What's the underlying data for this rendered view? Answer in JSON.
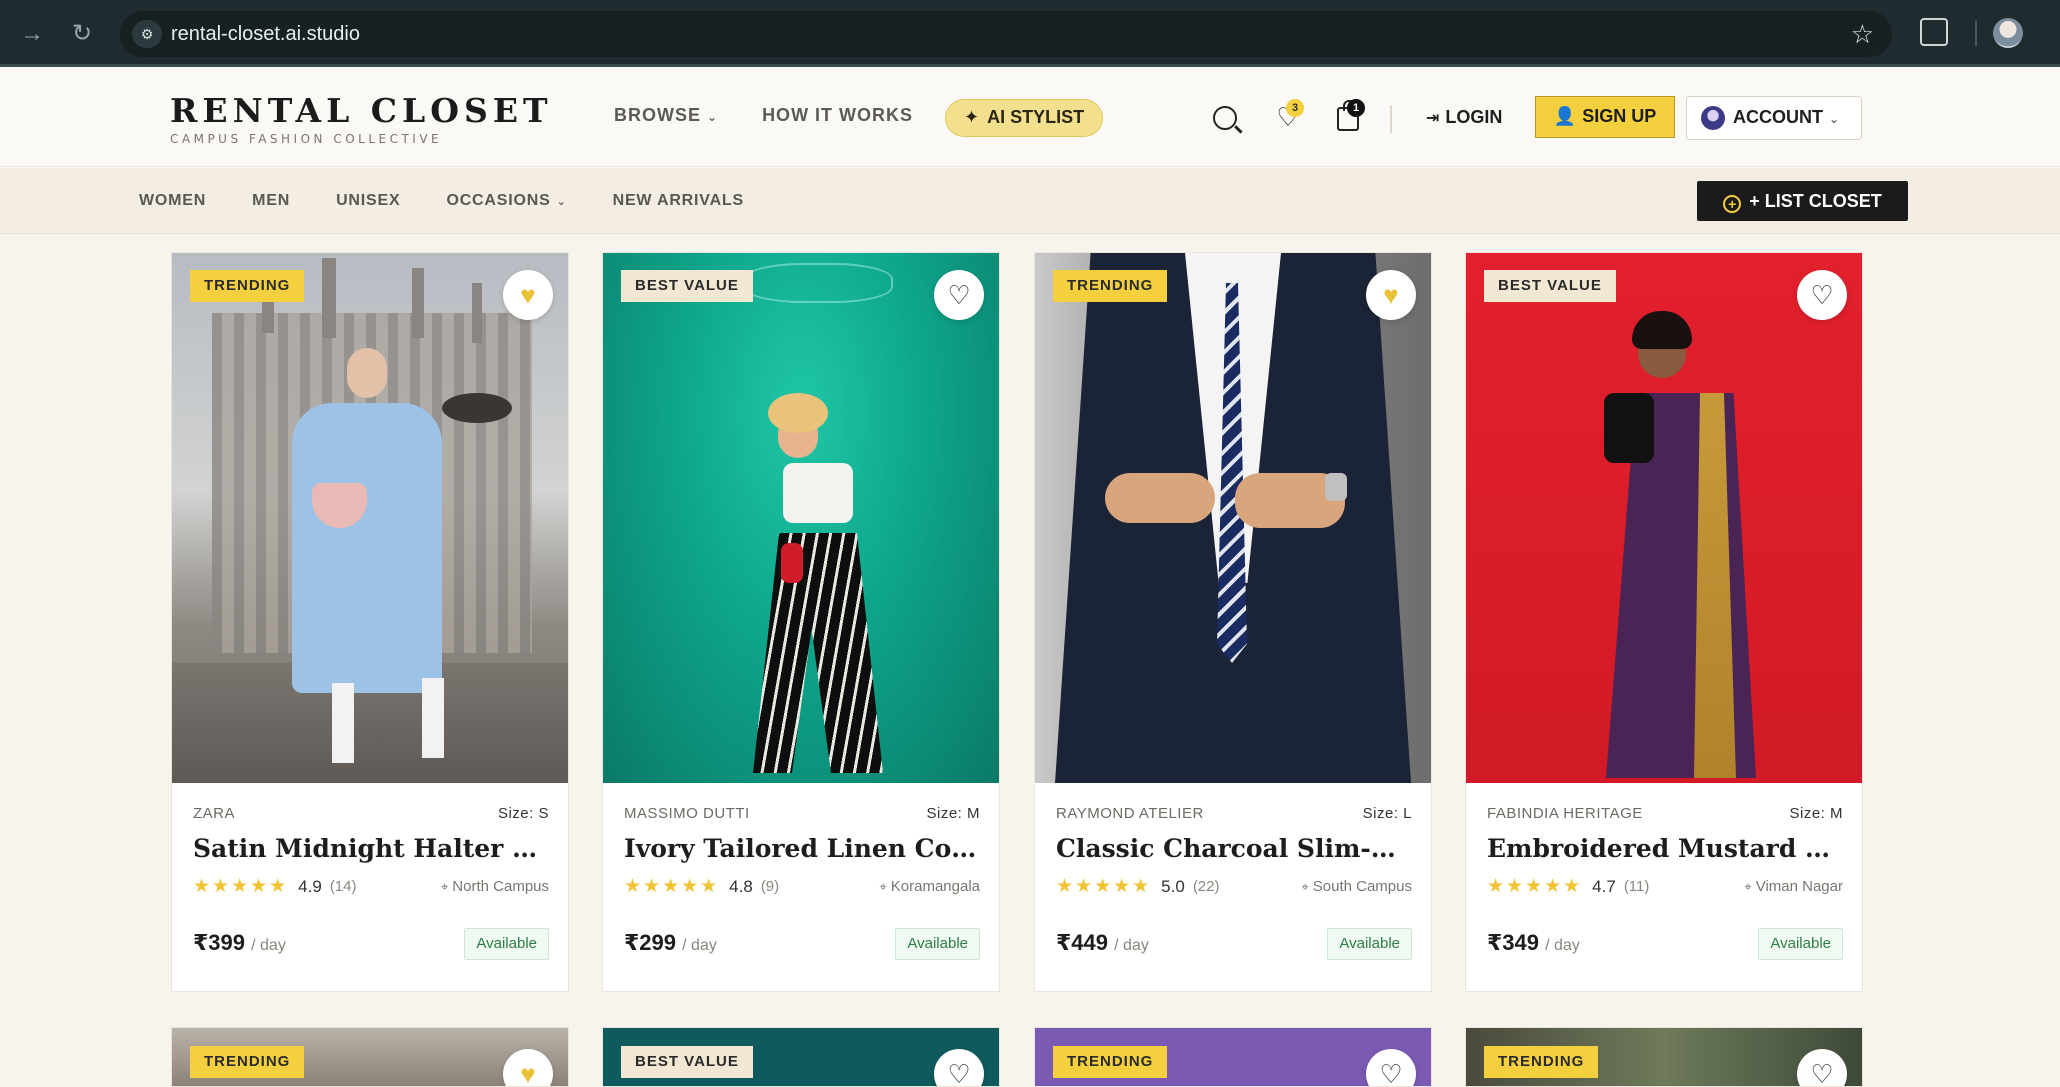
{
  "browser": {
    "url": "rental-closet.ai.studio"
  },
  "header": {
    "logo_name": "RENTAL CLOSET",
    "logo_tagline": "CAMPUS FASHION COLLECTIVE",
    "nav": {
      "browse": "BROWSE",
      "how_it_works": "HOW IT WORKS",
      "ai_stylist": "AI STYLIST"
    },
    "wishlist_count": "3",
    "cart_count": "1",
    "login": "LOGIN",
    "signup": "SIGN UP",
    "account": "ACCOUNT"
  },
  "subnav": {
    "links": [
      "WOMEN",
      "MEN",
      "UNISEX",
      "OCCASIONS",
      "NEW ARRIVALS"
    ],
    "list_closet": "+ LIST CLOSET"
  },
  "products": [
    {
      "tag": "TRENDING",
      "brand": "ZARA",
      "size": "Size: S",
      "name": "Satin Midnight Halter Dress",
      "rating": "4.9",
      "reviews": "(14)",
      "location": "North Campus",
      "price": "₹399",
      "unit": "/ day",
      "status": "Available",
      "favorited": true
    },
    {
      "tag": "BEST VALUE",
      "brand": "MASSIMO DUTTI",
      "size": "Size: M",
      "name": "Ivory Tailored Linen Co-ord",
      "rating": "4.8",
      "reviews": "(9)",
      "location": "Koramangala",
      "price": "₹299",
      "unit": "/ day",
      "status": "Available",
      "favorited": false
    },
    {
      "tag": "TRENDING",
      "brand": "RAYMOND ATELIER",
      "size": "Size: L",
      "name": "Classic Charcoal Slim-Fit...",
      "rating": "5.0",
      "reviews": "(22)",
      "location": "South Campus",
      "price": "₹449",
      "unit": "/ day",
      "status": "Available",
      "favorited": true
    },
    {
      "tag": "BEST VALUE",
      "brand": "FABINDIA HERITAGE",
      "size": "Size: M",
      "name": "Embroidered Mustard Silk...",
      "rating": "4.7",
      "reviews": "(11)",
      "location": "Viman Nagar",
      "price": "₹349",
      "unit": "/ day",
      "status": "Available",
      "favorited": false
    }
  ],
  "next_row_tags": [
    "TRENDING",
    "BEST VALUE",
    "TRENDING",
    "TRENDING"
  ],
  "colors": {
    "accent_yellow": "#f4d03f",
    "available_green": "#2d7d46",
    "dark": "#1b1b1b"
  }
}
